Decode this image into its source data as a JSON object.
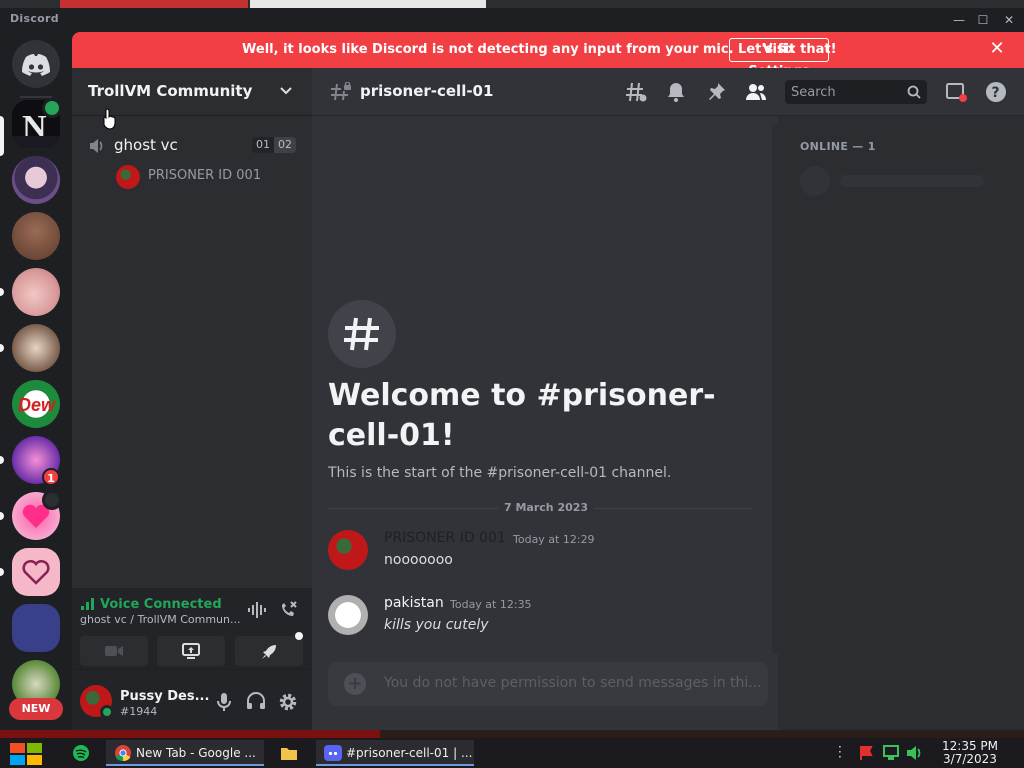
{
  "app": {
    "title": "Discord"
  },
  "banner": {
    "text": "Well, it looks like Discord is not detecting any input from your mic. Let's fix that!",
    "button": "Visit Settings"
  },
  "rail": {
    "badges": {
      "unread_count": "1"
    },
    "new_label": "NEW"
  },
  "sidebar": {
    "guild_name": "TrollVM Community",
    "voice_channel": {
      "name": "ghost vc",
      "count_left": "01",
      "count_right": "02"
    },
    "voice_user": "PRISONER ID 001"
  },
  "voice_panel": {
    "status": "Voice Connected",
    "location": "ghost vc / TrollVM Commun..."
  },
  "user_panel": {
    "name": "Pussy Des...",
    "tag": "#1944"
  },
  "channel": {
    "name": "prisoner-cell-01",
    "search_placeholder": "Search",
    "welcome_title": "Welcome to #prisoner-cell-01!",
    "welcome_sub": "This is the start of the #prisoner-cell-01 channel.",
    "date": "7 March 2023",
    "messages": [
      {
        "author": "PRISONER ID 001",
        "time": "Today at 12:29",
        "body": "nooooooo"
      },
      {
        "author": "pakistan",
        "time": "Today at 12:35",
        "body": "kills you cutely"
      }
    ],
    "composer_placeholder": "You do not have permission to send messages in thi..."
  },
  "members": {
    "header": "ONLINE — 1"
  },
  "taskbar": {
    "items": [
      {
        "label": "New Tab - Google ..."
      },
      {
        "label": "#prisoner-cell-01 | ..."
      }
    ],
    "time": "12:35 PM",
    "date": "3/7/2023"
  },
  "colors": {
    "accent_red": "#f23f43",
    "voice_green": "#23a55a",
    "blurple": "#5865f2"
  }
}
